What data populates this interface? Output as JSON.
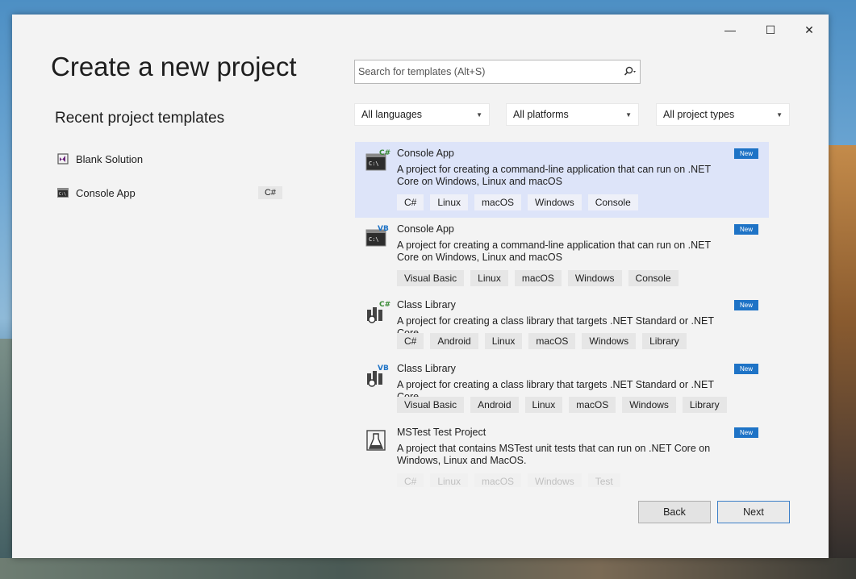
{
  "window": {
    "title": "Create a new project",
    "controls": {
      "minimize": "—",
      "maximize": "☐",
      "close": "✕"
    }
  },
  "recent": {
    "heading": "Recent project templates",
    "items": [
      {
        "label": "Blank Solution",
        "icon": "visual-studio-solution-icon",
        "badge": ""
      },
      {
        "label": "Console App",
        "icon": "console-app-icon",
        "badge": "C#"
      }
    ]
  },
  "search": {
    "placeholder": "Search for templates (Alt+S)"
  },
  "filters": {
    "language": "All languages",
    "platform": "All platforms",
    "project_type": "All project types"
  },
  "templates": [
    {
      "name": "Console App",
      "lang_mark": "C#",
      "icon": "console-app-csharp-icon",
      "badge": "New",
      "description": "A project for creating a command-line application that can run on .NET Core on Windows, Linux and macOS",
      "tags": [
        "C#",
        "Linux",
        "macOS",
        "Windows",
        "Console"
      ],
      "selected": true
    },
    {
      "name": "Console App",
      "lang_mark": "VB",
      "icon": "console-app-vb-icon",
      "badge": "New",
      "description": "A project for creating a command-line application that can run on .NET Core on Windows, Linux and macOS",
      "tags": [
        "Visual Basic",
        "Linux",
        "macOS",
        "Windows",
        "Console"
      ],
      "selected": false
    },
    {
      "name": "Class Library",
      "lang_mark": "C#",
      "icon": "class-library-csharp-icon",
      "badge": "New",
      "description": "A project for creating a class library that targets .NET Standard or .NET Core",
      "tags": [
        "C#",
        "Android",
        "Linux",
        "macOS",
        "Windows",
        "Library"
      ],
      "selected": false
    },
    {
      "name": "Class Library",
      "lang_mark": "VB",
      "icon": "class-library-vb-icon",
      "badge": "New",
      "description": "A project for creating a class library that targets .NET Standard or .NET Core",
      "tags": [
        "Visual Basic",
        "Android",
        "Linux",
        "macOS",
        "Windows",
        "Library"
      ],
      "selected": false
    },
    {
      "name": "MSTest Test Project",
      "lang_mark": "",
      "icon": "mstest-flask-icon",
      "badge": "New",
      "description": "A project that contains MSTest unit tests that can run on .NET Core on Windows, Linux and MacOS.",
      "tags": [
        "C#",
        "Linux",
        "macOS",
        "Windows",
        "Test"
      ],
      "selected": false
    }
  ],
  "buttons": {
    "back": "Back",
    "next": "Next"
  },
  "colors": {
    "selection": "#dde4f9",
    "new_badge": "#1e73c6",
    "csharp_mark": "#388a34",
    "vb_mark": "#1e73c6"
  }
}
